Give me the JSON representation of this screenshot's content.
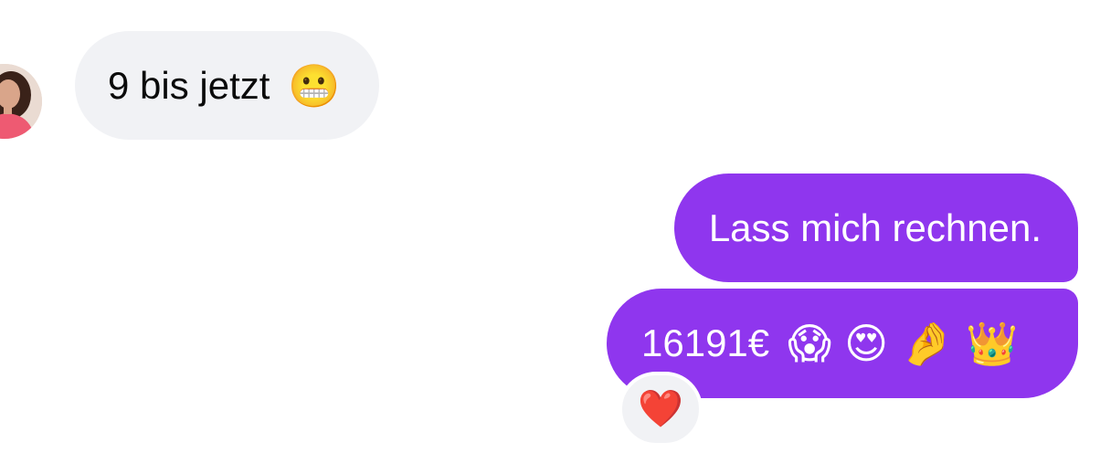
{
  "messages": [
    {
      "direction": "incoming",
      "text": "9 bis jetzt",
      "emojis": [
        "😬"
      ]
    },
    {
      "direction": "outgoing",
      "text": "Lass mich rechnen.",
      "emojis": []
    },
    {
      "direction": "outgoing",
      "text": "16191€",
      "emojis": [
        "😱",
        "😍",
        "🤌",
        "👑"
      ],
      "reaction": "❤️"
    }
  ],
  "colors": {
    "incoming_bubble": "#f1f2f5",
    "outgoing_bubble": "#8f36ee",
    "incoming_text": "#0a0a0a",
    "outgoing_text": "#ffffff"
  }
}
